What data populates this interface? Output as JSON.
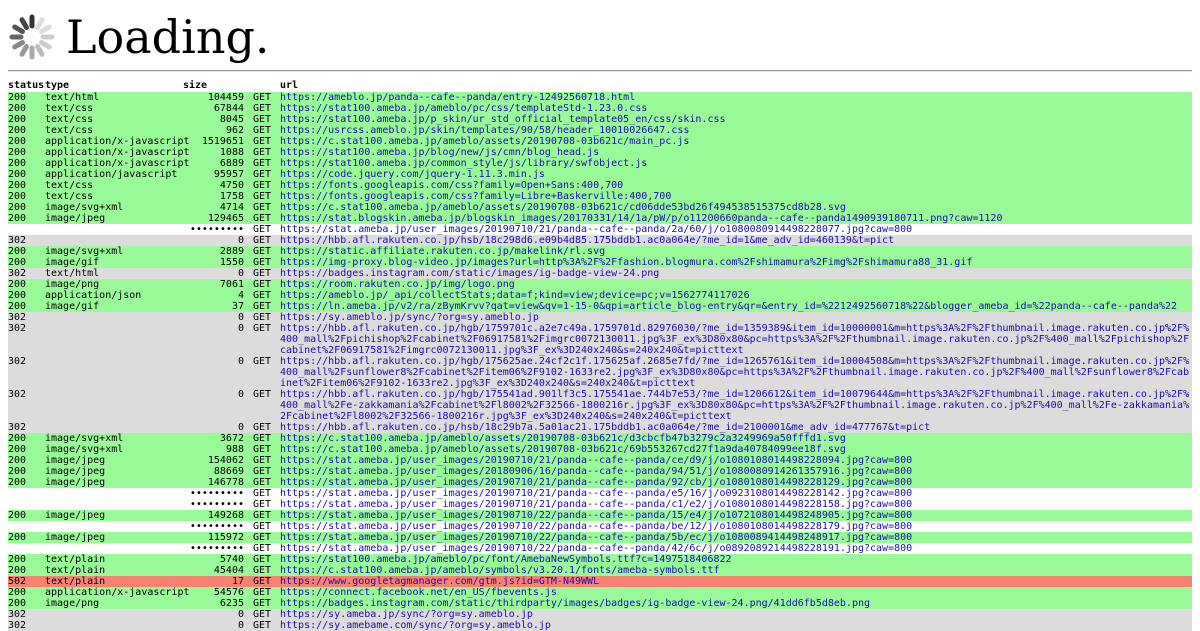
{
  "header": {
    "title": "Loading.",
    "spinner_icon": "spinner-icon"
  },
  "table": {
    "columns": {
      "status": "status",
      "type": "type",
      "size": "size",
      "method": "",
      "url": "url"
    },
    "rows": [
      {
        "status": "200",
        "type": "text/html",
        "size": "104459",
        "method": "GET",
        "url": "https://ameblo.jp/panda--cafe--panda/entry-12492560718.html",
        "state": "ok"
      },
      {
        "status": "200",
        "type": "text/css",
        "size": "67844",
        "method": "GET",
        "url": "https://stat100.ameba.jp/ameblo/pc/css/templateStd-1.23.0.css",
        "state": "ok"
      },
      {
        "status": "200",
        "type": "text/css",
        "size": "8045",
        "method": "GET",
        "url": "https://stat100.ameba.jp/p_skin/ur_std_official_template05_en/css/skin.css",
        "state": "ok"
      },
      {
        "status": "200",
        "type": "text/css",
        "size": "962",
        "method": "GET",
        "url": "https://usrcss.ameblo.jp/skin/templates/90/58/header_10010026647.css",
        "state": "ok"
      },
      {
        "status": "200",
        "type": "application/x-javascript",
        "size": "1519651",
        "method": "GET",
        "url": "https://c.stat100.ameba.jp/ameblo/assets/20190708-03b621c/main_pc.js",
        "state": "ok"
      },
      {
        "status": "200",
        "type": "application/x-javascript",
        "size": "1088",
        "method": "GET",
        "url": "https://stat100.ameba.jp/blog/new/js/cmn/blog_head.js",
        "state": "ok"
      },
      {
        "status": "200",
        "type": "application/x-javascript",
        "size": "6889",
        "method": "GET",
        "url": "https://stat100.ameba.jp/common_style/js/library/swfobject.js",
        "state": "ok"
      },
      {
        "status": "200",
        "type": "application/javascript",
        "size": "95957",
        "method": "GET",
        "url": "https://code.jquery.com/jquery-1.11.3.min.js",
        "state": "ok"
      },
      {
        "status": "200",
        "type": "text/css",
        "size": "4750",
        "method": "GET",
        "url": "https://fonts.googleapis.com/css?family=Open+Sans:400,700",
        "state": "ok"
      },
      {
        "status": "200",
        "type": "text/css",
        "size": "1758",
        "method": "GET",
        "url": "https://fonts.googleapis.com/css?family=Libre+Baskerville:400,700",
        "state": "ok"
      },
      {
        "status": "200",
        "type": "image/svg+xml",
        "size": "4714",
        "method": "GET",
        "url": "https://c.stat100.ameba.jp/ameblo/assets/20190708-03b621c/cd06dde53bd26f494538515375cd8b28.svg",
        "state": "ok"
      },
      {
        "status": "200",
        "type": "image/jpeg",
        "size": "129465",
        "method": "GET",
        "url": "https://stat.blogskin.ameba.jp/blogskin_images/20170331/14/1a/pW/p/o11200660panda--cafe--panda1490939180711.png?caw=1120",
        "state": "ok"
      },
      {
        "status": "",
        "type": "",
        "size": "•••••••••",
        "method": "GET",
        "url": "https://stat.ameba.jp/user_images/20190710/21/panda--cafe--panda/2a/60/j/o1080080914498228077.jpg?caw=800",
        "state": "pending"
      },
      {
        "status": "302",
        "type": "",
        "size": "0",
        "method": "GET",
        "url": "https://hbb.afl.rakuten.co.jp/hsb/18c298d6.e09b4d85.175bddb1.ac0a064e/?me_id=1&me_adv_id=460139&t=pict",
        "state": "redir"
      },
      {
        "status": "200",
        "type": "image/svg+xml",
        "size": "2889",
        "method": "GET",
        "url": "https://static.affiliate.rakuten.co.jp/makelink/rl.svg",
        "state": "ok"
      },
      {
        "status": "200",
        "type": "image/gif",
        "size": "1550",
        "method": "GET",
        "url": "https://img-proxy.blog-video.jp/images?url=http%3A%2F%2Ffashion.blogmura.com%2Fshimamura%2Fimg%2Fshimamura88_31.gif",
        "state": "ok"
      },
      {
        "status": "302",
        "type": "text/html",
        "size": "0",
        "method": "GET",
        "url": "https://badges.instagram.com/static/images/ig-badge-view-24.png",
        "state": "redir"
      },
      {
        "status": "200",
        "type": "image/png",
        "size": "7061",
        "method": "GET",
        "url": "https://room.rakuten.co.jp/img/logo.png",
        "state": "ok"
      },
      {
        "status": "200",
        "type": "application/json",
        "size": "4",
        "method": "GET",
        "url": "https://ameblo.jp/_api/collectStats;data=f;kind=view;device=pc;v=1562774117026",
        "state": "ok"
      },
      {
        "status": "200",
        "type": "image/gif",
        "size": "37",
        "method": "GET",
        "url": "https://ln.ameba.jp/v2/ra/zBymKrvv?qat=view&qv=1-15-0&qpi=article_blog-entry&qr=&entry_id=%2212492560718%22&blogger_ameba_id=%22panda--cafe--panda%22",
        "state": "ok"
      },
      {
        "status": "302",
        "type": "",
        "size": "0",
        "method": "GET",
        "url": "https://sy.ameblo.jp/sync/?org=sy.ameblo.jp",
        "state": "redir"
      },
      {
        "status": "302",
        "type": "",
        "size": "0",
        "method": "GET",
        "url": "https://hbb.afl.rakuten.co.jp/hgb/1759701c.a2e7c49a.1759701d.82976030/?me_id=1359389&item_id=10000001&m=https%3A%2F%2Fthumbnail.image.rakuten.co.jp%2F%400_mall%2Fpichishop%2Fcabinet%2F06917581%2Fimgrc0072130011.jpg%3F_ex%3D80x80&pc=https%3A%2F%2Fthumbnail.image.rakuten.co.jp%2F%400_mall%2Fpichishop%2Fcabinet%2F06917581%2Fimgrc0072130011.jpg%3F_ex%3D240x240&s=240x240&t=picttext",
        "state": "redir"
      },
      {
        "status": "302",
        "type": "",
        "size": "0",
        "method": "GET",
        "url": "https://hbb.afl.rakuten.co.jp/hgb/175625ae.24cf2c1f.175625af.2685e7fd/?me_id=1265761&item_id=10004508&m=https%3A%2F%2Fthumbnail.image.rakuten.co.jp%2F%400_mall%2Fsunflower8%2Fcabinet%2Fitem06%2F9102-1633re2.jpg%3F_ex%3D80x80&pc=https%3A%2F%2Fthumbnail.image.rakuten.co.jp%2F%400_mall%2Fsunflower8%2Fcabinet%2Fitem06%2F9102-1633re2.jpg%3F_ex%3D240x240&s=240x240&t=picttext",
        "state": "redir"
      },
      {
        "status": "302",
        "type": "",
        "size": "0",
        "method": "GET",
        "url": "https://hbb.afl.rakuten.co.jp/hgb/175541ad.901lf3c5.175541ae.744b7e53/?me_id=1206612&item_id=10079644&m=https%3A%2F%2Fthumbnail.image.rakuten.co.jp%2F%400_mall%2Fe-zakkamania%2Fcabinet%2Fl8002%2F32566-1800216r.jpg%3F_ex%3D80x80&pc=https%3A%2F%2Fthumbnail.image.rakuten.co.jp%2F%400_mall%2Fe-zakkamania%2Fcabinet%2Fl8002%2F32566-1800216r.jpg%3F_ex%3D240x240&s=240x240&t=picttext",
        "state": "redir"
      },
      {
        "status": "302",
        "type": "",
        "size": "0",
        "method": "GET",
        "url": "https://hbb.afl.rakuten.co.jp/hsb/18c29b7a.5a01ac21.175bddb1.ac0a064e/?me_id=2100001&me_adv_id=477767&t=pict",
        "state": "redir"
      },
      {
        "status": "200",
        "type": "image/svg+xml",
        "size": "3672",
        "method": "GET",
        "url": "https://c.stat100.ameba.jp/ameblo/assets/20190708-03b621c/d3cbcfb47b3279c2a3249969a50fffd1.svg",
        "state": "ok"
      },
      {
        "status": "200",
        "type": "image/svg+xml",
        "size": "988",
        "method": "GET",
        "url": "https://c.stat100.ameba.jp/ameblo/assets/20190708-03b621c/69b553267cd27f1a9da40784099ee18f.svg",
        "state": "ok"
      },
      {
        "status": "200",
        "type": "image/jpeg",
        "size": "154062",
        "method": "GET",
        "url": "https://stat.ameba.jp/user_images/20190710/21/panda--cafe--panda/ce/d9/j/o1080108014498228094.jpg?caw=800",
        "state": "ok"
      },
      {
        "status": "200",
        "type": "image/jpeg",
        "size": "88669",
        "method": "GET",
        "url": "https://stat.ameba.jp/user_images/20180906/16/panda--cafe--panda/94/51/j/o1080080914261357916.jpg?caw=800",
        "state": "ok"
      },
      {
        "status": "200",
        "type": "image/jpeg",
        "size": "146778",
        "method": "GET",
        "url": "https://stat.ameba.jp/user_images/20190710/21/panda--cafe--panda/92/cb/j/o1080108014498228129.jpg?caw=800",
        "state": "ok"
      },
      {
        "status": "",
        "type": "",
        "size": "•••••••••",
        "method": "GET",
        "url": "https://stat.ameba.jp/user_images/20190710/21/panda--cafe--panda/e5/16/j/o0923108014498228142.jpg?caw=800",
        "state": "pending"
      },
      {
        "status": "",
        "type": "",
        "size": "•••••••••",
        "method": "GET",
        "url": "https://stat.ameba.jp/user_images/20190710/21/panda--cafe--panda/c1/e2/j/o1080108014498228158.jpg?caw=800",
        "state": "pending"
      },
      {
        "status": "200",
        "type": "image/jpeg",
        "size": "149268",
        "method": "GET",
        "url": "https://stat.ameba.jp/user_images/20190710/22/panda--cafe--panda/15/e4/j/o1072108014498248905.jpg?caw=800",
        "state": "ok"
      },
      {
        "status": "",
        "type": "",
        "size": "•••••••••",
        "method": "GET",
        "url": "https://stat.ameba.jp/user_images/20190710/22/panda--cafe--panda/be/12/j/o1080108014498228179.jpg?caw=800",
        "state": "pending"
      },
      {
        "status": "200",
        "type": "image/jpeg",
        "size": "115972",
        "method": "GET",
        "url": "https://stat.ameba.jp/user_images/20190710/22/panda--cafe--panda/5b/ec/j/o1080089414498248917.jpg?caw=800",
        "state": "ok"
      },
      {
        "status": "",
        "type": "",
        "size": "•••••••••",
        "method": "GET",
        "url": "https://stat.ameba.jp/user_images/20190710/22/panda--cafe--panda/42/6c/j/o0892089214498228191.jpg?caw=800",
        "state": "pending"
      },
      {
        "status": "200",
        "type": "text/plain",
        "size": "5740",
        "method": "GET",
        "url": "https://stat100.ameba.jp/ameblo/pc/font/AmebaNewSymbols.ttf?c=1497518406822",
        "state": "ok"
      },
      {
        "status": "200",
        "type": "text/plain",
        "size": "45404",
        "method": "GET",
        "url": "https://c.stat100.ameba.jp/ameblo/symbols/v3.20.1/fonts/ameba-symbols.ttf",
        "state": "ok"
      },
      {
        "status": "502",
        "type": "text/plain",
        "size": "17",
        "method": "GET",
        "url": "https://www.googletagmanager.com/gtm.js?id=GTM-N49WWL",
        "state": "err"
      },
      {
        "status": "200",
        "type": "application/x-javascript",
        "size": "54576",
        "method": "GET",
        "url": "https://connect.facebook.net/en_US/fbevents.js",
        "state": "ok"
      },
      {
        "status": "200",
        "type": "image/png",
        "size": "6235",
        "method": "GET",
        "url": "https://badges.instagram.com/static/thirdparty/images/badges/ig-badge-view-24.png/41dd6fb5d8eb.png",
        "state": "ok"
      },
      {
        "status": "302",
        "type": "",
        "size": "0",
        "method": "GET",
        "url": "https://sy.ameba.jp/sync/?org=sy.ameblo.jp",
        "state": "redir"
      },
      {
        "status": "302",
        "type": "",
        "size": "0",
        "method": "GET",
        "url": "https://sy.amebame.com/sync/?org=sy.ameblo.jp",
        "state": "redir"
      }
    ]
  },
  "colors": {
    "ok": "#98fb98",
    "redirect": "#dcdcdc",
    "error": "#fa8072",
    "link": "#1a0dab"
  }
}
